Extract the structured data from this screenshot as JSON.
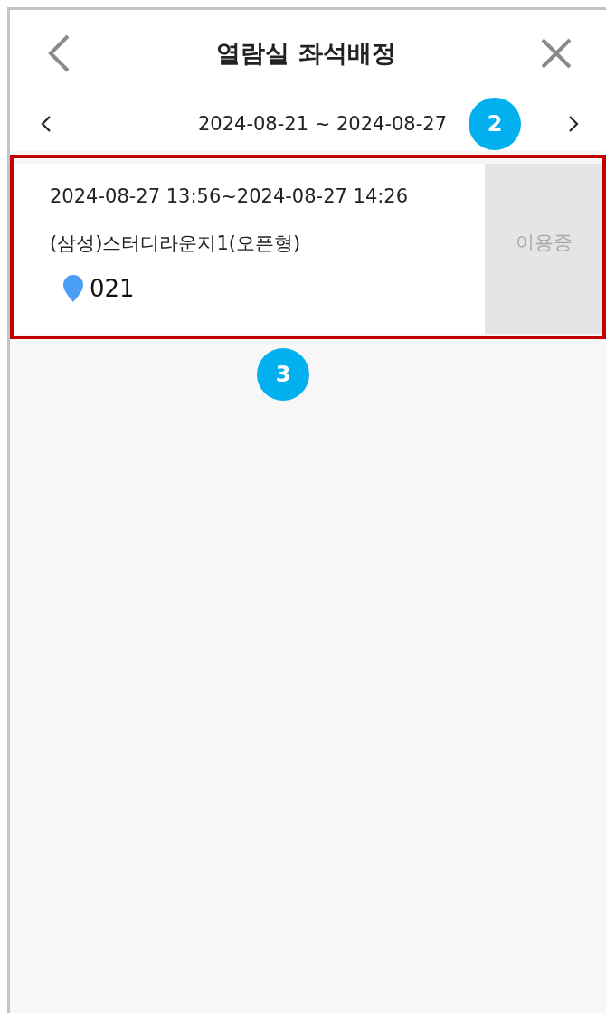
{
  "header": {
    "title": "열람실 좌석배정"
  },
  "date_range": {
    "label": "2024-08-21 ~ 2024-08-27",
    "annotation": "2"
  },
  "reservations": [
    {
      "time": "2024-08-27 13:56~2024-08-27 14:26",
      "room": "(삼성)스터디라운지1(오픈형)",
      "seat": "021",
      "status": "이용중",
      "highlighted": true,
      "annotation": "3"
    }
  ]
}
